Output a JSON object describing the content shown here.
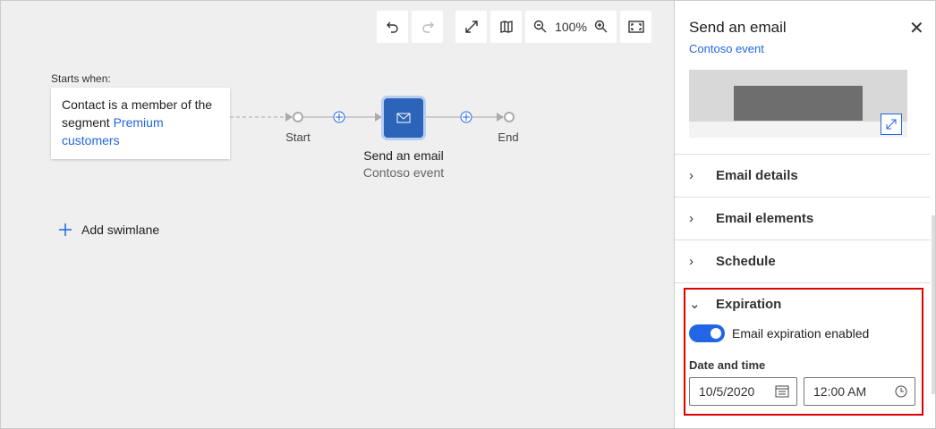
{
  "toolbar": {
    "zoom_level": "100%"
  },
  "canvas": {
    "starts_when": "Starts when:",
    "trigger_text": "Contact is a member of the segment ",
    "trigger_link": "Premium customers",
    "start_label": "Start",
    "end_label": "End",
    "tile_title": "Send an email",
    "tile_subtitle": "Contoso event",
    "add_swimlane": "Add swimlane"
  },
  "panel": {
    "title": "Send an email",
    "subtitle": "Contoso event",
    "sections": [
      "Email details",
      "Email elements",
      "Schedule"
    ],
    "expiration": {
      "title": "Expiration",
      "toggle_label": "Email expiration enabled",
      "toggle_on": true,
      "date_label": "Date and time",
      "date": "10/5/2020",
      "time": "12:00 AM"
    }
  },
  "colors": {
    "accent": "#2266e3",
    "highlight": "#e00000",
    "tile": "#2b64b8"
  }
}
